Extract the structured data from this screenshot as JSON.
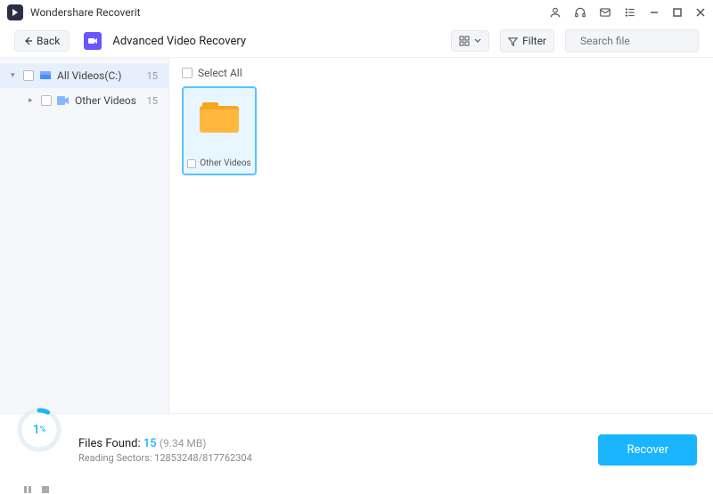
{
  "app": {
    "name": "Wondershare Recoverit"
  },
  "toolbar": {
    "back": "Back",
    "title": "Advanced Video Recovery",
    "filter": "Filter",
    "search_placeholder": "Search file"
  },
  "sidebar": {
    "items": [
      {
        "label": "All Videos(C:)",
        "count": "15"
      },
      {
        "label": "Other Videos",
        "count": "15"
      }
    ]
  },
  "main": {
    "select_all": "Select All",
    "tiles": [
      {
        "label": "Other Videos"
      }
    ]
  },
  "footer": {
    "percent": "1",
    "percent_suffix": "%",
    "found_label": "Files Found: ",
    "found_count": "15",
    "found_size": "(9.34 MB)",
    "sectors_label": "Reading Sectors: ",
    "sectors_value": "12853248/817762304",
    "recover": "Recover"
  }
}
